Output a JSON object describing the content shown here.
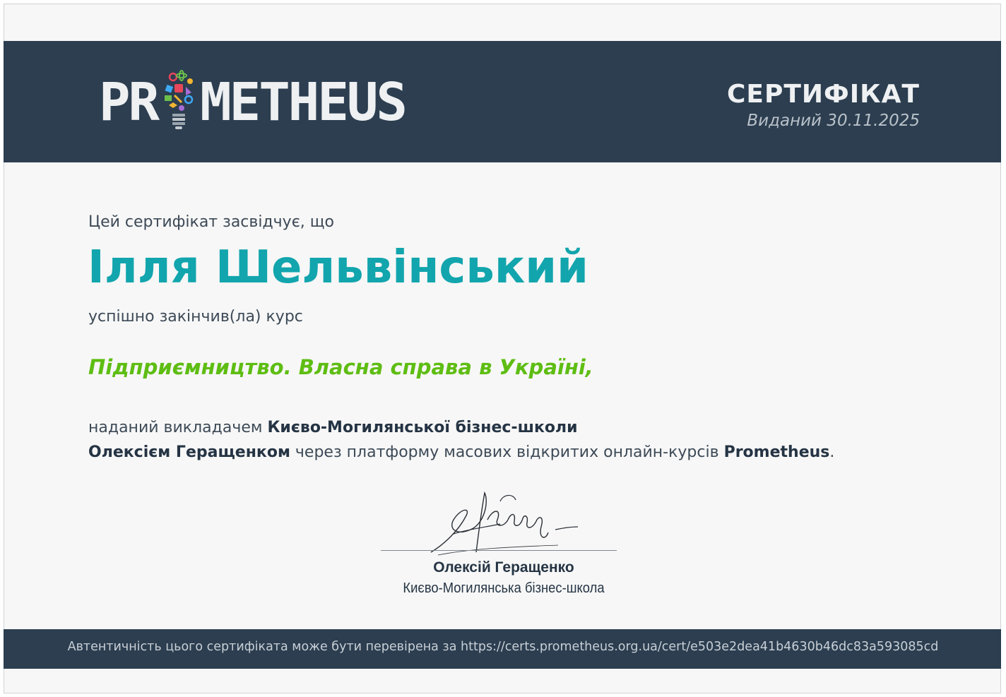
{
  "header": {
    "logo_text_left": "PR",
    "logo_text_right": "METHEUS",
    "title": "СЕРТИФІКАТ",
    "issued": "Виданий 30.11.2025"
  },
  "body": {
    "intro": "Цей сертифікат засвідчує, що",
    "recipient_name": "Ілля Шельвінський",
    "completed": "успішно закінчив(ла) курс",
    "course_title": "Підприємництво. Власна справа в Україні,",
    "provided_prefix": "наданий викладачем ",
    "institution": "Києво-Могилянської бізнес-школи",
    "instructor": "Олексієм Геращенком",
    "via_platform": " через платформу масових відкритих онлайн-курсів ",
    "platform": "Prometheus",
    "period": "."
  },
  "signature": {
    "name": "Олексій Геращенко",
    "organization": "Києво-Могилянська бізнес-школа"
  },
  "footer": {
    "verification": "Автентичність цього сертифіката може бути перевірена за https://certs.prometheus.org.ua/cert/e503e2dea41b4630b46dc83a593085cd"
  },
  "colors": {
    "header_bg": "#2c3e50",
    "name": "#12a5ad",
    "course": "#5ebd12"
  }
}
